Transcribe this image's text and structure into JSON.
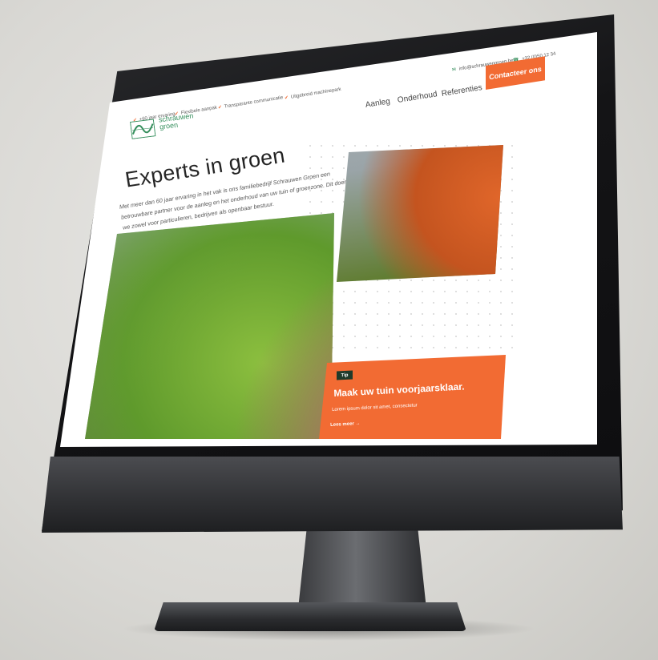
{
  "header": {
    "usps": [
      "+60 jaar ervaring",
      "Flexibele aanpak",
      "Transparante communicatie",
      "Uitgebreid machinepark"
    ],
    "email": "info@schrauwengroen.be",
    "phone": "+32 (0)50 12 34",
    "nav": [
      "Aanleg",
      "Onderhoud",
      "Referenties"
    ],
    "cta_label": "Contacteer ons"
  },
  "logo": {
    "line1": "schrauwen",
    "line2": "groen"
  },
  "hero": {
    "title": "Experts in groen",
    "intro": "Met meer dan 60 jaar ervaring in het vak is ons familiebedrijf Schrauwen Groen een betrouwbare partner voor de aanleg en het onderhoud van uw tuin of groenzone. Dit doen we zowel voor particulieren, bedrijven als openbaar bestuur."
  },
  "tip": {
    "badge": "Tip",
    "title": "Maak uw tuin voorjaarsklaar.",
    "text": "Lorem ipsum dolor sit amet, consectetur",
    "link": "Lees meer"
  },
  "colors": {
    "accent": "#f26b33",
    "brand_green": "#2e8b57",
    "badge_dark": "#1f3a2a"
  }
}
